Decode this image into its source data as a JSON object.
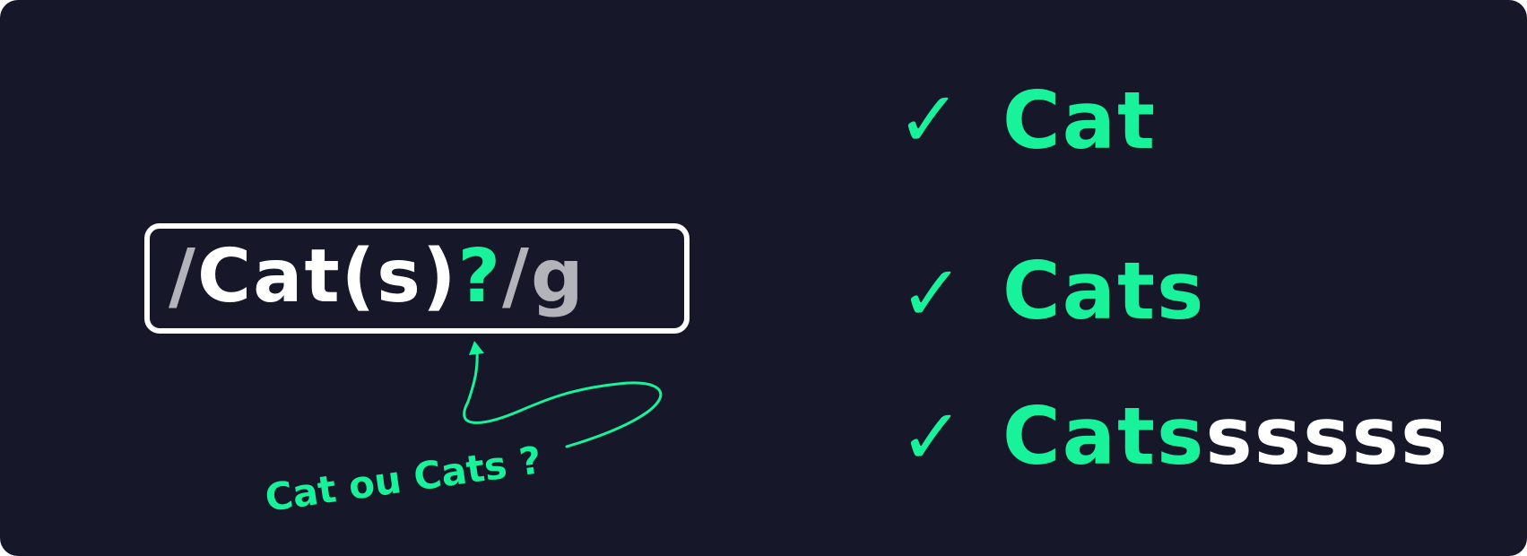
{
  "colors": {
    "background": "#161829",
    "accent": "#18f29a",
    "text_main": "#ffffff",
    "text_muted": "#b3b4ba"
  },
  "regex": {
    "slash_open": "/",
    "literal": "Cat",
    "group_open": "(",
    "group_char": "s",
    "group_close": ")",
    "quantifier": "?",
    "slash_close": "/",
    "flag": "g"
  },
  "annotation": {
    "text": "Cat ou Cats ?"
  },
  "matches": [
    {
      "icon": "check-icon",
      "matched": "Cat",
      "rest": ""
    },
    {
      "icon": "check-icon",
      "matched": "Cats",
      "rest": ""
    },
    {
      "icon": "check-icon",
      "matched": "Cats",
      "rest": "sssss"
    }
  ],
  "match_checks": [
    "✓",
    "✓",
    "✓"
  ]
}
